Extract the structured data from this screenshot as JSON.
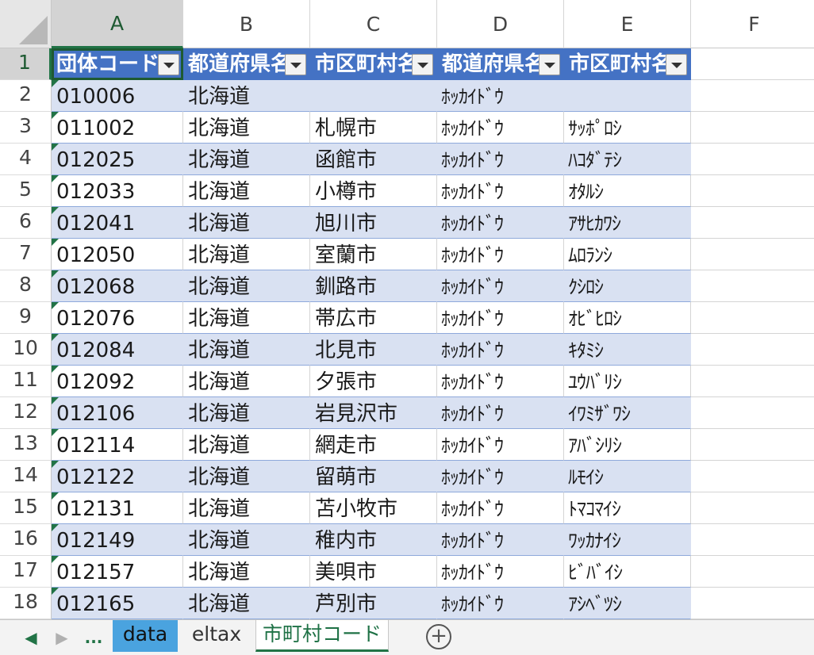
{
  "columns": [
    "A",
    "B",
    "C",
    "D",
    "E",
    "F"
  ],
  "row_numbers": [
    "1",
    "2",
    "3",
    "4",
    "5",
    "6",
    "7",
    "8",
    "9",
    "10",
    "11",
    "12",
    "13",
    "14",
    "15",
    "16",
    "17",
    "18"
  ],
  "table_headers": [
    "団体コード",
    "都道府県名",
    "市区町村名",
    "都道府県名",
    "市区町村名"
  ],
  "rows": [
    [
      "010006",
      "北海道",
      "",
      "ﾎｯｶｲﾄﾞｳ",
      ""
    ],
    [
      "011002",
      "北海道",
      "札幌市",
      "ﾎｯｶｲﾄﾞｳ",
      "ｻｯﾎﾟﾛｼ"
    ],
    [
      "012025",
      "北海道",
      "函館市",
      "ﾎｯｶｲﾄﾞｳ",
      "ﾊｺﾀﾞﾃｼ"
    ],
    [
      "012033",
      "北海道",
      "小樽市",
      "ﾎｯｶｲﾄﾞｳ",
      "ｵﾀﾙｼ"
    ],
    [
      "012041",
      "北海道",
      "旭川市",
      "ﾎｯｶｲﾄﾞｳ",
      "ｱｻﾋｶﾜｼ"
    ],
    [
      "012050",
      "北海道",
      "室蘭市",
      "ﾎｯｶｲﾄﾞｳ",
      "ﾑﾛﾗﾝｼ"
    ],
    [
      "012068",
      "北海道",
      "釧路市",
      "ﾎｯｶｲﾄﾞｳ",
      "ｸｼﾛｼ"
    ],
    [
      "012076",
      "北海道",
      "帯広市",
      "ﾎｯｶｲﾄﾞｳ",
      "ｵﾋﾞﾋﾛｼ"
    ],
    [
      "012084",
      "北海道",
      "北見市",
      "ﾎｯｶｲﾄﾞｳ",
      "ｷﾀﾐｼ"
    ],
    [
      "012092",
      "北海道",
      "夕張市",
      "ﾎｯｶｲﾄﾞｳ",
      "ﾕｳﾊﾞﾘｼ"
    ],
    [
      "012106",
      "北海道",
      "岩見沢市",
      "ﾎｯｶｲﾄﾞｳ",
      "ｲﾜﾐｻﾞﾜｼ"
    ],
    [
      "012114",
      "北海道",
      "網走市",
      "ﾎｯｶｲﾄﾞｳ",
      "ｱﾊﾞｼﾘｼ"
    ],
    [
      "012122",
      "北海道",
      "留萌市",
      "ﾎｯｶｲﾄﾞｳ",
      "ﾙﾓｲｼ"
    ],
    [
      "012131",
      "北海道",
      "苫小牧市",
      "ﾎｯｶｲﾄﾞｳ",
      "ﾄﾏｺﾏｲｼ"
    ],
    [
      "012149",
      "北海道",
      "稚内市",
      "ﾎｯｶｲﾄﾞｳ",
      "ﾜｯｶﾅｲｼ"
    ],
    [
      "012157",
      "北海道",
      "美唄市",
      "ﾎｯｶｲﾄﾞｳ",
      "ﾋﾞﾊﾞｲｼ"
    ],
    [
      "012165",
      "北海道",
      "芦別市",
      "ﾎｯｶｲﾄﾞｳ",
      "ｱｼﾍﾞﾂｼ"
    ]
  ],
  "sheet_tabs": {
    "ellipsis": "...",
    "tabs": [
      "data",
      "eltax",
      "市町村コード"
    ],
    "add": "+"
  },
  "nav": {
    "prev": "◀",
    "next": "▶"
  },
  "colors": {
    "table_header": "#4472c4",
    "band": "#d9e1f2",
    "accent": "#217346",
    "highlight_tab": "#4aa3df"
  }
}
